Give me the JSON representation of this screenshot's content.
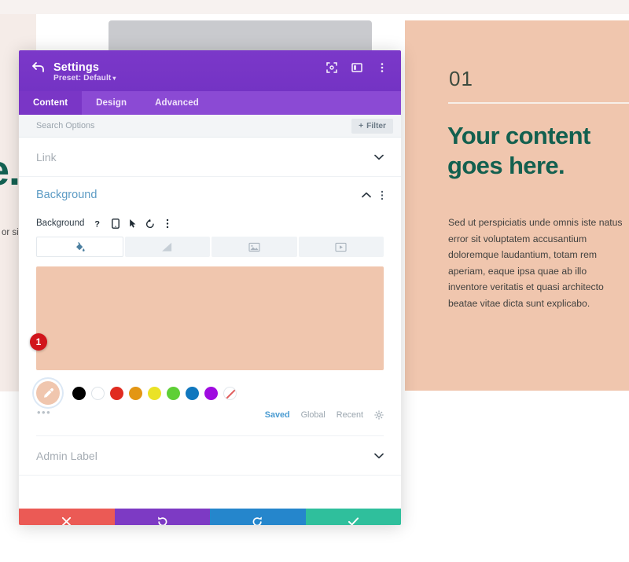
{
  "page": {
    "background_color": "#ffffff",
    "left_backdrop": {
      "big_text": "e.",
      "body_text": "or sit ntium",
      "panel_color": "#f5ece8",
      "accent_color": "#136152"
    },
    "gray_card_color": "#c9cace"
  },
  "right_panel": {
    "background_color": "#f0c6ae",
    "number": "01",
    "heading": "Your content goes here.",
    "body": "Sed ut perspiciatis unde omnis iste natus error sit voluptatem accusantium doloremque laudantium, totam rem aperiam, eaque ipsa quae ab illo inventore veritatis et quasi architecto beatae vitae dicta sunt explicabo.",
    "heading_color": "#13604f",
    "number_color": "#3d4b3f"
  },
  "modal": {
    "header": {
      "title": "Settings",
      "preset_label": "Preset: Default",
      "preset_caret": "▾",
      "back_icon": "back-arrow-icon",
      "icons": [
        "fullscreen-icon",
        "layout-toggle-icon",
        "more-vertical-icon"
      ],
      "background_color": "#7a3cc4"
    },
    "tabs": [
      {
        "label": "Content",
        "active": true
      },
      {
        "label": "Design",
        "active": false
      },
      {
        "label": "Advanced",
        "active": false
      }
    ],
    "search": {
      "value": "",
      "placeholder": "Search Options",
      "filter_label": "Filter",
      "filter_icon": "plus-icon"
    },
    "sections": [
      {
        "name": "Link",
        "state": "collapsed",
        "chevron": "chevron-down-icon"
      },
      {
        "name": "Background",
        "state": "expanded",
        "chevron": "chevron-up-icon"
      },
      {
        "name": "Admin Label",
        "state": "collapsed",
        "chevron": "chevron-down-icon"
      }
    ],
    "background_field": {
      "label": "Background",
      "icons": [
        "help-icon",
        "responsive-device-icon",
        "hover-cursor-icon",
        "reset-icon",
        "more-vertical-icon"
      ],
      "type_tabs": [
        {
          "name": "background-color",
          "icon": "paint-bucket-icon",
          "active": true
        },
        {
          "name": "background-gradient",
          "icon": "gradient-icon",
          "active": false
        },
        {
          "name": "background-image",
          "icon": "image-icon",
          "active": false
        },
        {
          "name": "background-video",
          "icon": "video-icon",
          "active": false
        }
      ],
      "preview_color": "#f0c6ae",
      "badge_number": "1",
      "badge_color": "#d1151b",
      "selected_swatch": {
        "color": "#f0c6ae",
        "icon": "eyedropper-icon"
      },
      "more_colors_icon": "ellipsis-icon",
      "swatches": [
        {
          "name": "black",
          "color": "#000000"
        },
        {
          "name": "white",
          "color": "#ffffff"
        },
        {
          "name": "red",
          "color": "#e02b20"
        },
        {
          "name": "orange",
          "color": "#e39614"
        },
        {
          "name": "yellow",
          "color": "#eae226"
        },
        {
          "name": "green",
          "color": "#5ecf36"
        },
        {
          "name": "blue",
          "color": "#1077be"
        },
        {
          "name": "purple",
          "color": "#9f0ae0"
        },
        {
          "name": "transparent",
          "color": "transparent"
        }
      ],
      "picker_links": [
        {
          "label": "Saved",
          "active": true
        },
        {
          "label": "Global",
          "active": false
        },
        {
          "label": "Recent",
          "active": false
        }
      ],
      "settings_icon": "gear-icon"
    },
    "footer": [
      {
        "name": "cancel",
        "icon": "close-icon",
        "color": "#eb5a55"
      },
      {
        "name": "undo",
        "icon": "undo-icon",
        "color": "#7d3ac4"
      },
      {
        "name": "redo",
        "icon": "redo-icon",
        "color": "#2586cc"
      },
      {
        "name": "save",
        "icon": "check-icon",
        "color": "#2fbf9c"
      }
    ]
  }
}
